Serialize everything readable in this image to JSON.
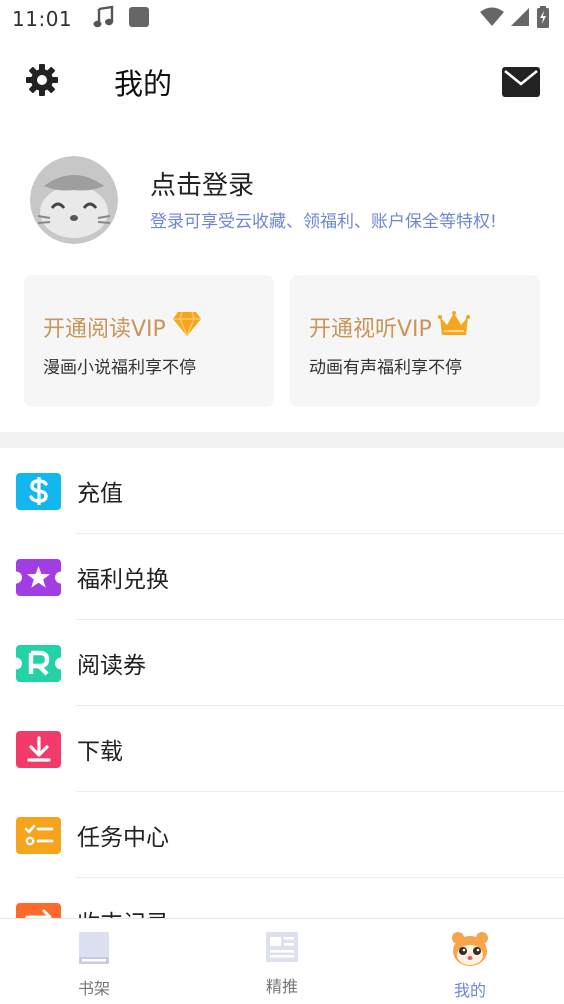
{
  "status_bar": {
    "time": "11:01",
    "icons": [
      "music-icon",
      "square-notification-icon",
      "wifi-icon",
      "signal-icon",
      "battery-icon"
    ]
  },
  "header": {
    "title": "我的",
    "settings_icon": "gear-icon",
    "mail_icon": "mail-icon"
  },
  "profile": {
    "login_title": "点击登录",
    "login_subtitle": "登录可享受云收藏、领福利、账户保全等特权!"
  },
  "vip_cards": [
    {
      "title": "开通阅读VIP",
      "subtitle": "漫画小说福利享不停",
      "icon": "diamond-icon"
    },
    {
      "title": "开通视听VIP",
      "subtitle": "动画有声福利享不停",
      "icon": "crown-icon"
    }
  ],
  "menu": [
    {
      "label": "充值",
      "icon": "dollar-icon",
      "color": "#12b7f0"
    },
    {
      "label": "福利兑换",
      "icon": "star-ticket-icon",
      "color": "#a23de6"
    },
    {
      "label": "阅读券",
      "icon": "r-ticket-icon",
      "color": "#22d3a6"
    },
    {
      "label": "下载",
      "icon": "download-icon",
      "color": "#f23b6a"
    },
    {
      "label": "任务中心",
      "icon": "task-list-icon",
      "color": "#f7a31b"
    },
    {
      "label": "收支记录",
      "icon": "transfer-icon",
      "color": "#ff6a2b"
    }
  ],
  "bottom_nav": {
    "items": [
      {
        "label": "书架",
        "icon": "bookshelf-icon",
        "active": false
      },
      {
        "label": "精推",
        "icon": "news-icon",
        "active": false
      },
      {
        "label": "我的",
        "icon": "mascot-icon",
        "active": true
      }
    ],
    "active_color": "#6f86d6"
  }
}
